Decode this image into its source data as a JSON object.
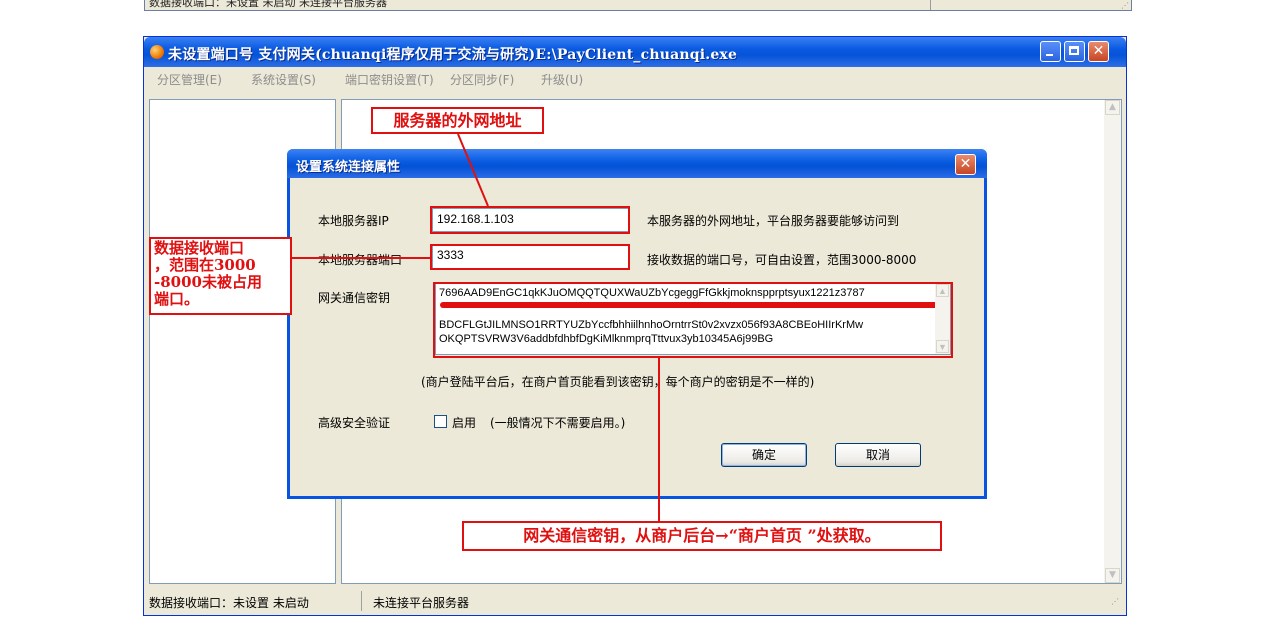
{
  "prev_window": {
    "status_text": "数据接收端口：未设置 未启动  未连接平台服务器"
  },
  "window": {
    "title": "未设置端口号  支付网关(chuanqi程序仅用于交流与研究)E:\\PayClient_chuanqi.exe",
    "controls": {
      "minimize": "_",
      "maximize": "□",
      "close": "✕"
    }
  },
  "menu": [
    {
      "label": "分区管理(E)"
    },
    {
      "label": "系统设置(S)"
    },
    {
      "label": "端口密钥设置(T)"
    },
    {
      "label": "分区同步(F)"
    },
    {
      "label": "升级(U)"
    }
  ],
  "status": {
    "port_status": "数据接收端口：未设置 未启动",
    "server_status": "未连接平台服务器"
  },
  "dialog": {
    "title": "设置系统连接属性",
    "close_label": "✕",
    "ip": {
      "label": "本地服务器IP",
      "value": "192.168.1.103",
      "hint": "本服务器的外网地址，平台服务器要能够访问到"
    },
    "port": {
      "label": "本地服务器端口",
      "value": "3333",
      "hint": "接收数据的端口号，可自由设置，范围3000-8000"
    },
    "key": {
      "label": "网关通信密钥",
      "lines": [
        "7696AAD9EnGC1qkKJuOMQQTQUXWaUZbYcgeggFfGkkjmoknspprptsyux1221z3787",
        "",
        "BDCFLGtJILMNSO1RRTYUZbYccfbhhiilhnhoOrntrrSt0v2xvzx056f93A8CBEoHIIrKrMw",
        "OKQPTSVRW3V6addbfdhbfDgKiMlknmprqTttvux3yb10345A6j99BG"
      ],
      "note": "(商户登陆平台后，在商户首页能看到该密钥，每个商户的密钥是不一样的)"
    },
    "security": {
      "label": "高级安全验证",
      "checkbox_label": "启用",
      "note": "(一般情况下不需要启用。)",
      "checked": false
    },
    "ok_label": "确定",
    "cancel_label": "取消"
  },
  "annotations": {
    "server_address": "服务器的外网地址",
    "port_note": "数据接收端口，范围在3000-8000未被占用端口。",
    "port_note_lines": [
      "数据接收端口",
      "，范围在3000",
      "-8000未被占用",
      "端口。"
    ],
    "key_source": "网关通信密钥，从商户后台→“商户首页 ”处获取。"
  },
  "colors": {
    "annotation": "#e01010",
    "titlebar": "#0a5ae1"
  }
}
